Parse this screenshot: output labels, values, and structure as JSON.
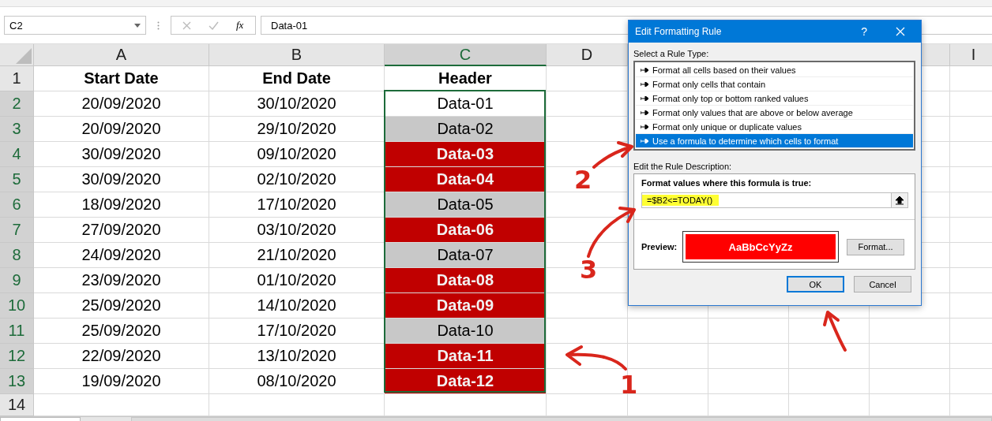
{
  "name_box": {
    "value": "C2"
  },
  "formula_bar": {
    "fx": "fx",
    "value": "Data-01"
  },
  "columns": [
    {
      "label": "A",
      "selected": false
    },
    {
      "label": "B",
      "selected": false
    },
    {
      "label": "C",
      "selected": true
    },
    {
      "label": "D",
      "selected": false
    },
    {
      "label": "I",
      "selected": false
    }
  ],
  "rows": [
    {
      "number": "1",
      "selected": false,
      "cells": [
        "Start Date",
        "End Date",
        "Header"
      ],
      "kind": "header"
    },
    {
      "number": "2",
      "selected": true,
      "cells": [
        "20/09/2020",
        "30/10/2020",
        "Data-01"
      ],
      "kind": "plain"
    },
    {
      "number": "3",
      "selected": true,
      "cells": [
        "20/09/2020",
        "29/10/2020",
        "Data-02"
      ],
      "kind": "grey"
    },
    {
      "number": "4",
      "selected": true,
      "cells": [
        "30/09/2020",
        "09/10/2020",
        "Data-03"
      ],
      "kind": "red"
    },
    {
      "number": "5",
      "selected": true,
      "cells": [
        "30/09/2020",
        "02/10/2020",
        "Data-04"
      ],
      "kind": "red"
    },
    {
      "number": "6",
      "selected": true,
      "cells": [
        "18/09/2020",
        "17/10/2020",
        "Data-05"
      ],
      "kind": "grey"
    },
    {
      "number": "7",
      "selected": true,
      "cells": [
        "27/09/2020",
        "03/10/2020",
        "Data-06"
      ],
      "kind": "red"
    },
    {
      "number": "8",
      "selected": true,
      "cells": [
        "24/09/2020",
        "21/10/2020",
        "Data-07"
      ],
      "kind": "grey"
    },
    {
      "number": "9",
      "selected": true,
      "cells": [
        "23/09/2020",
        "01/10/2020",
        "Data-08"
      ],
      "kind": "red"
    },
    {
      "number": "10",
      "selected": true,
      "cells": [
        "25/09/2020",
        "14/10/2020",
        "Data-09"
      ],
      "kind": "red"
    },
    {
      "number": "11",
      "selected": true,
      "cells": [
        "25/09/2020",
        "17/10/2020",
        "Data-10"
      ],
      "kind": "grey"
    },
    {
      "number": "12",
      "selected": true,
      "cells": [
        "22/09/2020",
        "13/10/2020",
        "Data-11"
      ],
      "kind": "red"
    },
    {
      "number": "13",
      "selected": true,
      "cells": [
        "19/09/2020",
        "08/10/2020",
        "Data-12"
      ],
      "kind": "red"
    },
    {
      "number": "14",
      "selected": false,
      "cells": []
    }
  ],
  "dialog": {
    "title": "Edit Formatting Rule",
    "help": "?",
    "rule_type_label": "Select a Rule Type:",
    "rule_types": [
      {
        "label": "Format all cells based on their values",
        "selected": false
      },
      {
        "label": "Format only cells that contain",
        "selected": false
      },
      {
        "label": "Format only top or bottom ranked values",
        "selected": false
      },
      {
        "label": "Format only values that are above or below average",
        "selected": false
      },
      {
        "label": "Format only unique or duplicate values",
        "selected": false
      },
      {
        "label": "Use a formula to determine which cells to format",
        "selected": true
      }
    ],
    "description_label": "Edit the Rule Description:",
    "formula_label": "Format values where this formula is true:",
    "formula": "=$B2<=TODAY()",
    "preview_label": "Preview:",
    "preview_text": "AaBbCcYyZz",
    "format_button": "Format...",
    "ok_button": "OK",
    "cancel_button": "Cancel"
  },
  "annotations": [
    "1",
    "2",
    "3"
  ]
}
